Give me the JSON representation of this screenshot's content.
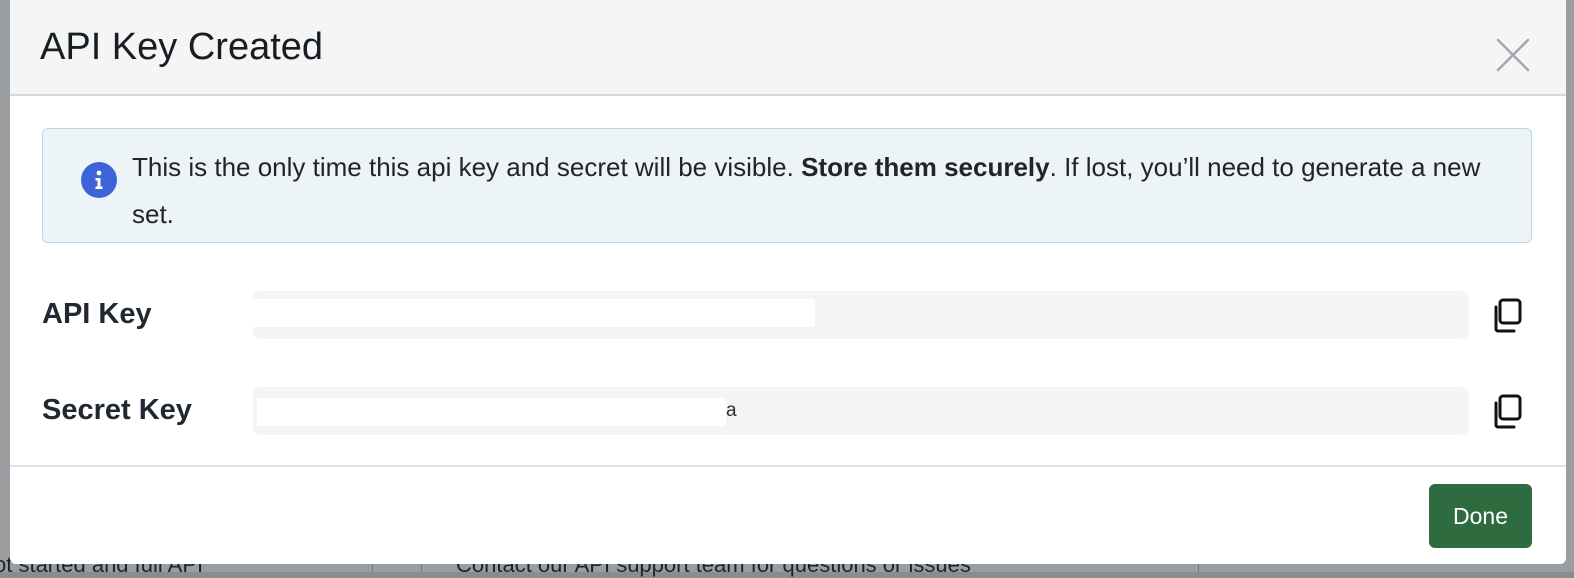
{
  "backdrop": {
    "left_text": "ot started and full API",
    "right_text": "Contact our API support team for questions or issues"
  },
  "modal": {
    "title": "API Key Created",
    "close_icon": "close-icon",
    "alert": {
      "icon": "info-icon",
      "text_before": "This is the only time this api key and secret will be visible. ",
      "text_bold": "Store them securely",
      "text_after": ". If lost, you’ll need to generate a new set."
    },
    "fields": {
      "api_key": {
        "label": "API Key",
        "value": "",
        "copy_icon": "copy-icon"
      },
      "secret_key": {
        "label": "Secret Key",
        "value": "",
        "visible_tail": "a",
        "copy_icon": "copy-icon"
      }
    },
    "footer": {
      "done_label": "Done"
    }
  },
  "colors": {
    "header_bg": "#f4f5f6",
    "alert_bg": "#edf4f8",
    "alert_border": "#b7d6ee",
    "info_icon": "#3d63d6",
    "done_button": "#2e6b3f",
    "field_bg": "#f3f4f6"
  }
}
